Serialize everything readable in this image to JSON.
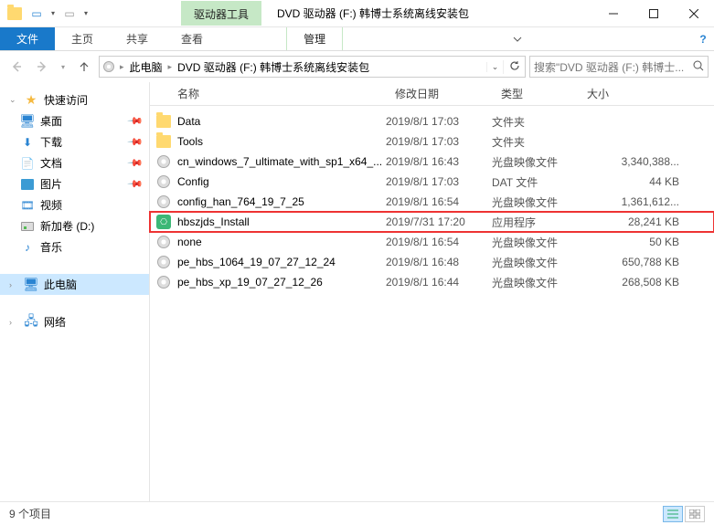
{
  "titlebar": {
    "tool_tab": "驱动器工具",
    "title": "DVD 驱动器 (F:) 韩博士系统离线安装包"
  },
  "ribbon": {
    "file": "文件",
    "home": "主页",
    "share": "共享",
    "view": "查看",
    "manage": "管理"
  },
  "breadcrumb": {
    "root": "此电脑",
    "drive": "DVD 驱动器 (F:) 韩博士系统离线安装包"
  },
  "search": {
    "placeholder": "搜索\"DVD 驱动器 (F:) 韩博士..."
  },
  "sidebar": {
    "quick": "快速访问",
    "desktop": "桌面",
    "downloads": "下载",
    "documents": "文档",
    "pictures": "图片",
    "videos": "视频",
    "volume_d": "新加卷 (D:)",
    "music": "音乐",
    "thispc": "此电脑",
    "network": "网络"
  },
  "columns": {
    "name": "名称",
    "date": "修改日期",
    "type": "类型",
    "size": "大小"
  },
  "files": [
    {
      "icon": "folder",
      "name": "Data",
      "date": "2019/8/1 17:03",
      "type": "文件夹",
      "size": ""
    },
    {
      "icon": "folder",
      "name": "Tools",
      "date": "2019/8/1 17:03",
      "type": "文件夹",
      "size": ""
    },
    {
      "icon": "disc",
      "name": "cn_windows_7_ultimate_with_sp1_x64_...",
      "date": "2019/8/1 16:43",
      "type": "光盘映像文件",
      "size": "3,340,388..."
    },
    {
      "icon": "disc",
      "name": "Config",
      "date": "2019/8/1 17:03",
      "type": "DAT 文件",
      "size": "44 KB"
    },
    {
      "icon": "disc",
      "name": "config_han_764_19_7_25",
      "date": "2019/8/1 16:54",
      "type": "光盘映像文件",
      "size": "1,361,612..."
    },
    {
      "icon": "exe",
      "name": "hbszjds_Install",
      "date": "2019/7/31 17:20",
      "type": "应用程序",
      "size": "28,241 KB",
      "hl": true
    },
    {
      "icon": "disc",
      "name": "none",
      "date": "2019/8/1 16:54",
      "type": "光盘映像文件",
      "size": "50 KB"
    },
    {
      "icon": "disc",
      "name": "pe_hbs_1064_19_07_27_12_24",
      "date": "2019/8/1 16:48",
      "type": "光盘映像文件",
      "size": "650,788 KB"
    },
    {
      "icon": "disc",
      "name": "pe_hbs_xp_19_07_27_12_26",
      "date": "2019/8/1 16:44",
      "type": "光盘映像文件",
      "size": "268,508 KB"
    }
  ],
  "status": {
    "count": "9 个项目"
  }
}
